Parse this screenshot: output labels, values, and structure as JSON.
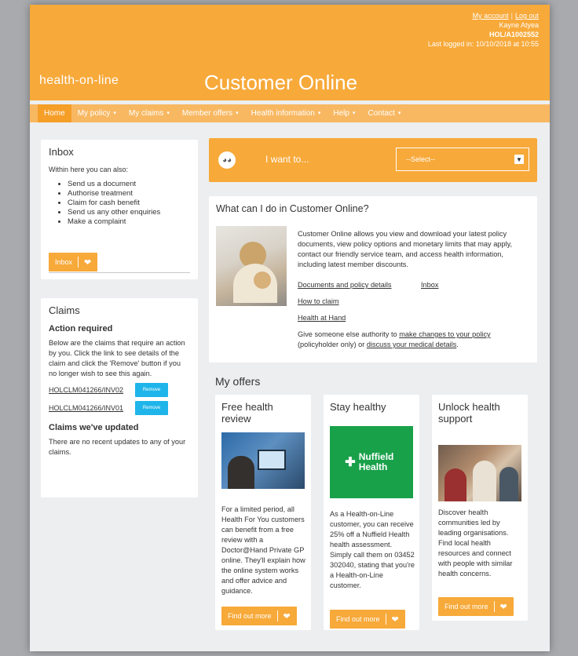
{
  "header": {
    "my_account": "My account",
    "log_out": "Log out",
    "user_name": "Kayne Atyea",
    "member_id": "HOL/A1002552",
    "last_logged_in": "Last logged in: 10/10/2018 at 10:55",
    "brand": "health-on-line",
    "title": "Customer Online"
  },
  "nav": {
    "items": [
      {
        "label": "Home",
        "active": true
      },
      {
        "label": "My policy",
        "caret": "⌄"
      },
      {
        "label": "My claims",
        "caret": "⌄"
      },
      {
        "label": "Member offers",
        "caret": "⌄"
      },
      {
        "label": "Health information",
        "caret": "⌄"
      },
      {
        "label": "Help",
        "caret": "⌄"
      },
      {
        "label": "Contact",
        "caret": "⌄"
      }
    ]
  },
  "inbox": {
    "title": "Inbox",
    "intro": "Within here you can also:",
    "items": [
      "Send us a document",
      "Authorise treatment",
      "Claim for cash benefit",
      "Send us any other enquiries",
      "Make a complaint"
    ],
    "button": "Inbox"
  },
  "claims": {
    "title": "Claims",
    "action_heading": "Action required",
    "action_text": "Below are the claims that require an action by you. Click the link to see details of the claim and click the 'Remove' button if you no longer wish to see this again.",
    "rows": [
      {
        "id": "HOLCLM041266/INV02",
        "button": "Remove"
      },
      {
        "id": "HOLCLM041266/INV01",
        "button": "Remove"
      }
    ],
    "updated_heading": "Claims we've updated",
    "updated_text": "There are no recent updates to any of your claims."
  },
  "iwant": {
    "label": "I want to...",
    "select_value": "--Select--",
    "icon": "owl-icon"
  },
  "whatcan": {
    "title": "What can I do in Customer Online?",
    "description": "Customer Online allows you view and download your latest policy documents, view policy options and monetary limits that may apply, contact our friendly service team, and access health information, including latest member discounts.",
    "link_documents": "Documents and policy details",
    "link_inbox": "Inbox",
    "link_claim": "How to claim",
    "link_health": "Health at Hand",
    "give_prefix": "Give someone else authority to ",
    "give_link1": "make changes to your policy",
    "give_mid": " (policyholder only) or ",
    "give_link2": "discuss your medical details",
    "give_suffix": "."
  },
  "offers": {
    "heading": "My offers",
    "button": "Find out more",
    "cards": [
      {
        "title": "Free health review",
        "text": "For a limited period, all Health For You customers can benefit from a free review with a Doctor@Hand Private GP online. They'll explain how the online system works and offer advice and guidance."
      },
      {
        "title": "Stay healthy",
        "logo": "Nuffield Health",
        "text": "As a Health-on-Line customer, you can receive 25% off a Nuffield Health health assessment. Simply call them on 03452 302040, stating that you're a Health-on-Line customer."
      },
      {
        "title": "Unlock health support",
        "text": "Discover health communities led by leading organisations. Find local health resources and connect with people with similar health concerns."
      }
    ]
  },
  "colors": {
    "accent": "#f7a93a",
    "nav": "#f8b862",
    "remove": "#1fb5ea",
    "nuffield": "#19a14a"
  }
}
